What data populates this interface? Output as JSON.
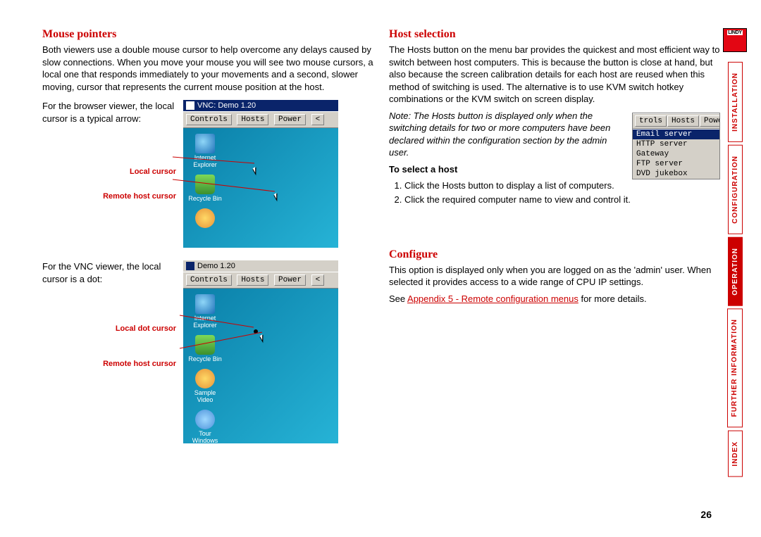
{
  "left": {
    "heading": "Mouse pointers",
    "intro": "Both viewers use a double mouse cursor to help overcome any delays caused by slow connections. When you move your mouse you will see two mouse cursors, a local one that responds immediately to your movements and a second, slower moving, cursor that represents the current mouse position at the host.",
    "browser_caption": "For the browser viewer, the local cursor is a typical arrow:",
    "annot_local": "Local cursor",
    "annot_remote": "Remote host cursor",
    "vnc_caption": "For the VNC viewer, the local cursor is a dot:",
    "annot_localdot": "Local dot cursor",
    "annot_remote2": "Remote host cursor",
    "shot1_title": "VNC: Demo 1.20",
    "shot2_title": "Demo 1.20",
    "toolbar_controls": "Controls",
    "toolbar_hosts": "Hosts",
    "toolbar_power": "Power",
    "icon_ie": "Internet Explorer",
    "icon_bin": "Recycle Bin",
    "icon_sample": "Sample Video",
    "icon_tour": "Tour Windows XP"
  },
  "right": {
    "heading_host": "Host selection",
    "host_para": "The Hosts button on the menu bar provides the quickest and most efficient way to switch between host computers. This is because the button is close at hand, but also because the screen calibration details for each host are reused when this method of switching is used. The alternative is to use KVM switch hotkey combinations or the KVM switch on screen display.",
    "host_note": "Note: The Hosts button is displayed only when the switching details for two or more computers have been declared within the configuration section by the admin user.",
    "to_select": "To select a host",
    "step1": "Click the Hosts button to display a list of computers.",
    "step2": "Click the required computer name to view and control it.",
    "dropdown_toolbar_trols": "trols",
    "dropdown_toolbar_hosts": "Hosts",
    "dropdown_toolbar_power": "Power",
    "menu_items": {
      "i0": "Email server",
      "i1": "HTTP server",
      "i2": "Gateway",
      "i3": "FTP server",
      "i4": "DVD jukebox"
    },
    "heading_config": "Configure",
    "config_para": "This option is displayed only when you are logged on as the 'admin' user. When selected it provides access to a wide range of CPU IP settings.",
    "config_see_prefix": "See ",
    "config_link": "Appendix 5 - Remote configuration menus",
    "config_see_suffix": " for more details."
  },
  "rail": {
    "logo": "LINDY",
    "nav0": "INSTALLATION",
    "nav1": "CONFIGURATION",
    "nav2": "OPERATION",
    "nav3": "FURTHER INFORMATION",
    "nav4": "INDEX"
  },
  "pagenum": "26"
}
